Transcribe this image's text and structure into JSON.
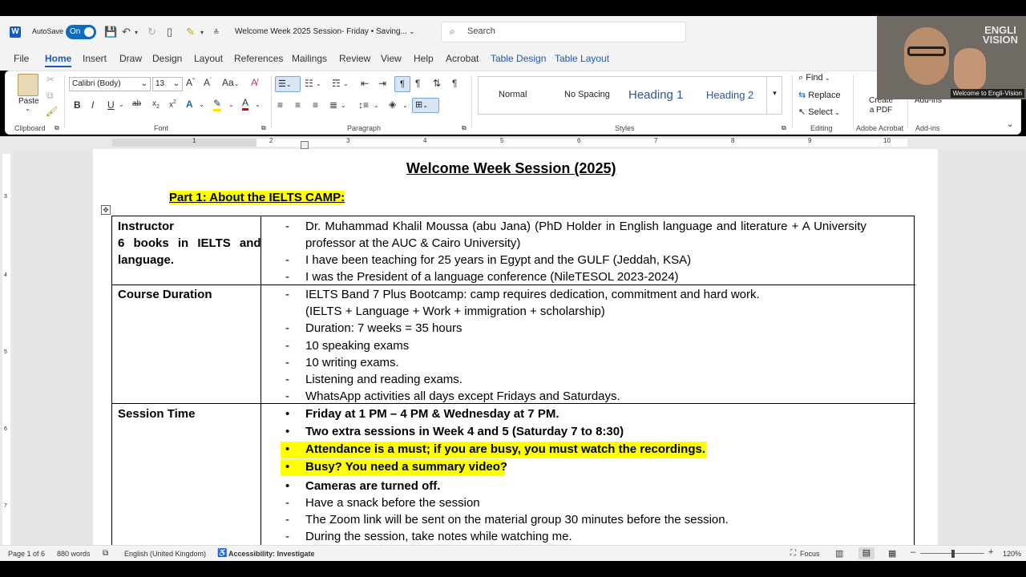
{
  "titlebar": {
    "autosave_label": "AutoSave",
    "autosave_state": "On",
    "doc_title": "Welcome Week  2025 Session- Friday • Saving...",
    "search_placeholder": "Search"
  },
  "tabs": [
    "File",
    "Home",
    "Insert",
    "Draw",
    "Design",
    "Layout",
    "References",
    "Mailings",
    "Review",
    "View",
    "Help",
    "Acrobat",
    "Table Design",
    "Table Layout"
  ],
  "ribbon": {
    "clipboard": {
      "paste": "Paste",
      "label": "Clipboard"
    },
    "font": {
      "name": "Calibri (Body)",
      "size": "13",
      "label": "Font",
      "case_btn": "Aa"
    },
    "paragraph": {
      "label": "Paragraph"
    },
    "styles": {
      "items": [
        "Normal",
        "No Spacing",
        "Heading 1",
        "Heading 2"
      ],
      "label": "Styles"
    },
    "editing": {
      "find": "Find",
      "replace": "Replace",
      "select": "Select",
      "label": "Editing"
    },
    "acrobat": {
      "create_pdf": "Create a PDF",
      "label": "Adobe Acrobat"
    },
    "addins": {
      "button": "Add-ins",
      "label": "Add-ins"
    }
  },
  "ruler_numbers": [
    "1",
    "2",
    "3",
    "4",
    "5",
    "6",
    "7",
    "8",
    "9",
    "10"
  ],
  "vruler_numbers": [
    "3",
    "4",
    "5",
    "6",
    "7"
  ],
  "webcam": {
    "logo_line1": "ENGLI",
    "logo_line2": "VISION",
    "caption": "Welcome to Engli-Vision"
  },
  "document": {
    "title": "Welcome Week Session (2025)",
    "part_title": "Part 1: About the IELTS CAMP:",
    "rows": [
      {
        "header_lines": [
          "Instructor",
          "6 books in IELTS and",
          "language."
        ],
        "items": [
          {
            "marker": "-",
            "text": "Dr. Muhammad Khalil Moussa (abu Jana) (PhD Holder in English language and literature + A University"
          },
          {
            "marker": "",
            "text": "professor at the AUC & Cairo University)"
          },
          {
            "marker": "-",
            "text": "I have been teaching for 25 years in Egypt and the GULF (Jeddah, KSA)"
          },
          {
            "marker": "-",
            "text": "I was the President of a language conference (NileTESOL 2023-2024)"
          }
        ]
      },
      {
        "header_lines": [
          "Course Duration"
        ],
        "items": [
          {
            "marker": "-",
            "text": "IELTS Band 7 Plus Bootcamp: camp requires dedication, commitment and hard work."
          },
          {
            "marker": "",
            "text": "(IELTS + Language + Work + immigration + scholarship)"
          },
          {
            "marker": "-",
            "text": "Duration: 7 weeks = 35 hours"
          },
          {
            "marker": "-",
            "text": "10 speaking exams"
          },
          {
            "marker": "-",
            "text": "10 writing exams."
          },
          {
            "marker": "-",
            "text": "Listening and reading exams."
          },
          {
            "marker": "-",
            "text": "WhatsApp activities all days except Fridays and Saturdays."
          }
        ]
      },
      {
        "header_lines": [
          "Session Time"
        ],
        "items": [
          {
            "marker": "•",
            "text": "Friday at 1 PM – 4 PM  & Wednesday at 7 PM."
          },
          {
            "marker": "•",
            "text": "Two extra sessions in Week 4 and 5 (Saturday 7 to 8:30)"
          },
          {
            "marker": "•",
            "text": "Attendance is a must; if you are busy, you must watch the recordings."
          },
          {
            "marker": "•",
            "text": "Busy? You need a summary video?"
          },
          {
            "marker": "•",
            "text": "Cameras are turned off."
          },
          {
            "marker": "-",
            "text": "Have a snack before the session"
          },
          {
            "marker": "-",
            "text": "The Zoom link will be sent on the material group 30 minutes before the session."
          },
          {
            "marker": "-",
            "text": "During the session, take notes while watching me."
          }
        ]
      }
    ]
  },
  "status": {
    "page": "Page 1 of 6",
    "words": "880 words",
    "language": "English (United Kingdom)",
    "accessibility": "Accessibility: Investigate",
    "focus": "Focus",
    "zoom": "120%"
  }
}
